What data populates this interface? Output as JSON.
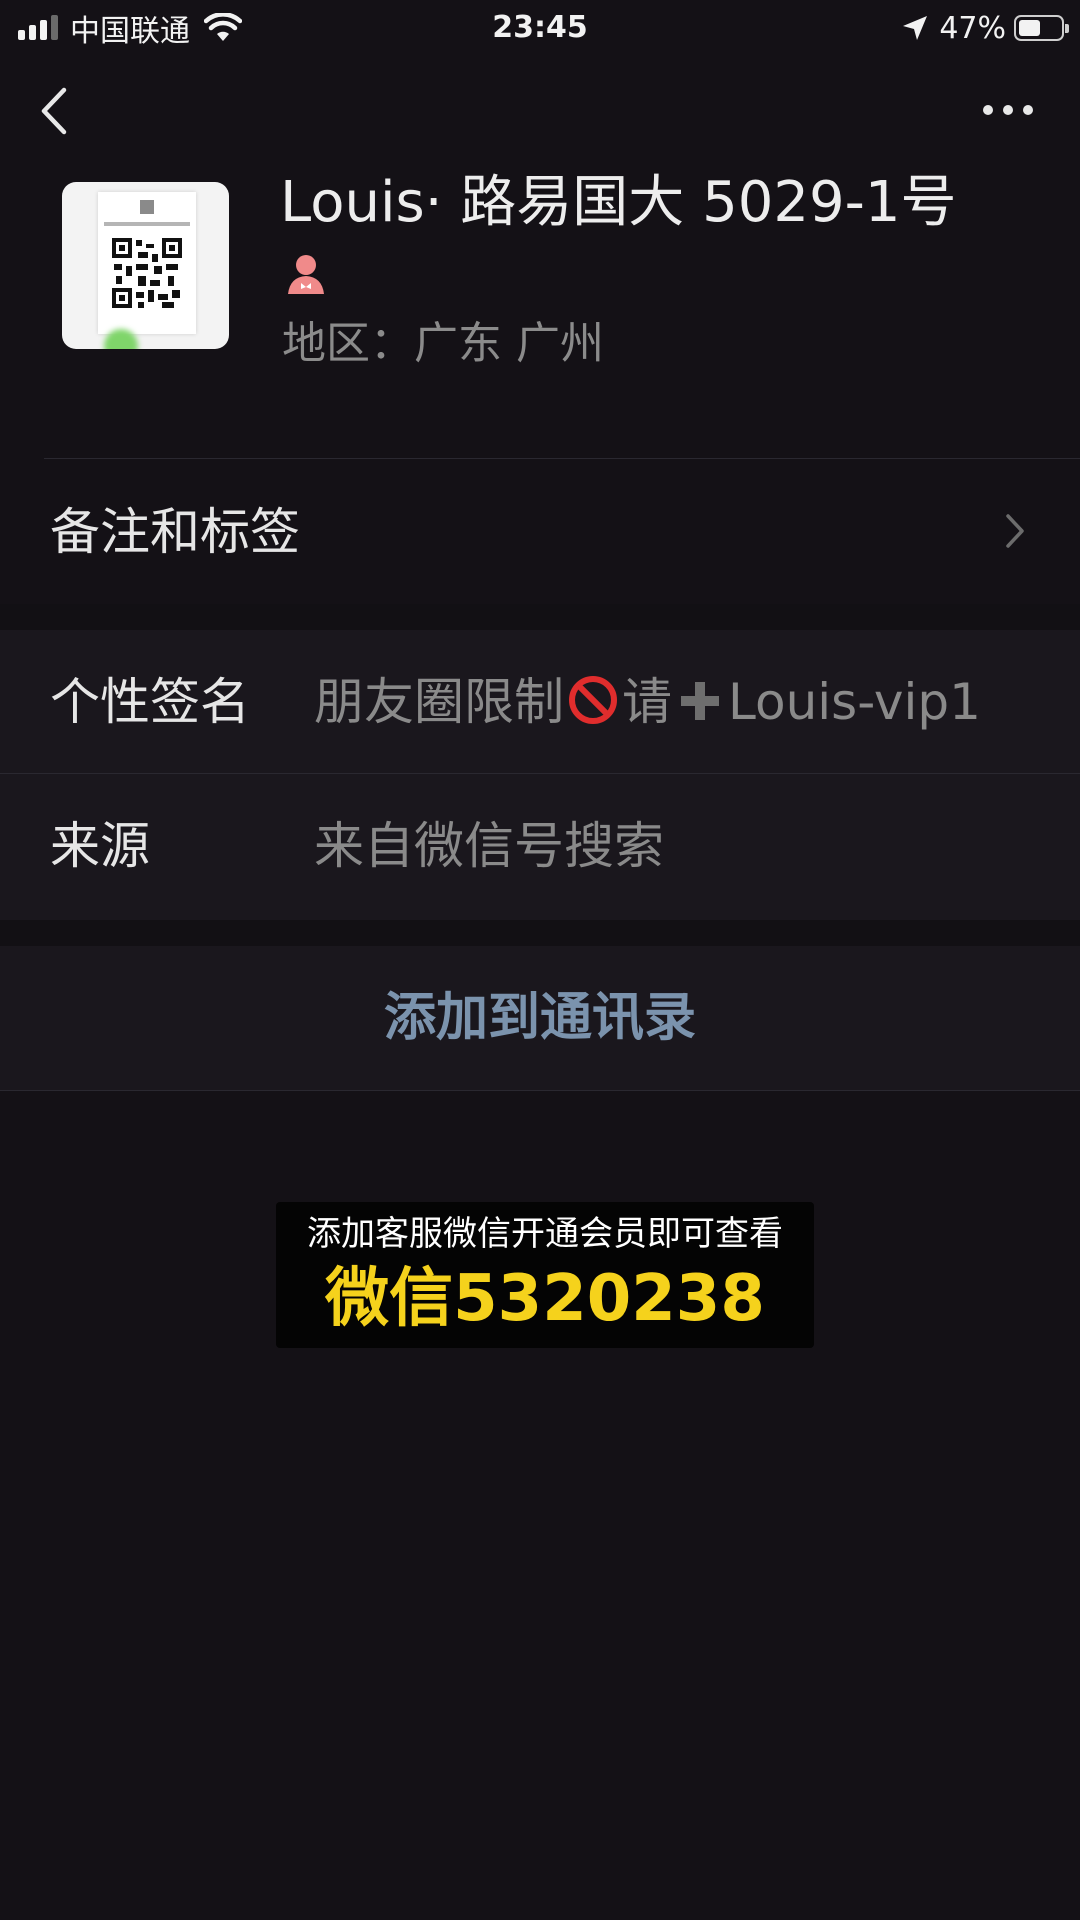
{
  "status_bar": {
    "carrier": "中国联通",
    "time": "23:45",
    "battery_percent": "47%",
    "battery_level": 0.47,
    "signal_bars": 3
  },
  "nav": {
    "back_icon": "chevron-left-icon",
    "more_icon": "more-dots-icon"
  },
  "profile": {
    "name": "Louis· 路易国大 5029-1号",
    "gender_icon": "female-icon",
    "region": "地区：广东 广州"
  },
  "remarks_row": {
    "label": "备注和标签"
  },
  "signature_row": {
    "label": "个性签名",
    "value_prefix": "朋友圈限制",
    "value_mid": "请",
    "value_suffix": "Louis-vip1"
  },
  "source_row": {
    "label": "来源",
    "value": "来自微信号搜索"
  },
  "add_button": {
    "label": "添加到通讯录"
  },
  "ad_banner": {
    "line1": "添加客服微信开通会员即可查看",
    "line2": "微信5320238"
  },
  "colors": {
    "background": "#141116",
    "row_background": "#1a171d",
    "link_blue": "#7b93ad",
    "ad_yellow": "#f5d21c"
  }
}
